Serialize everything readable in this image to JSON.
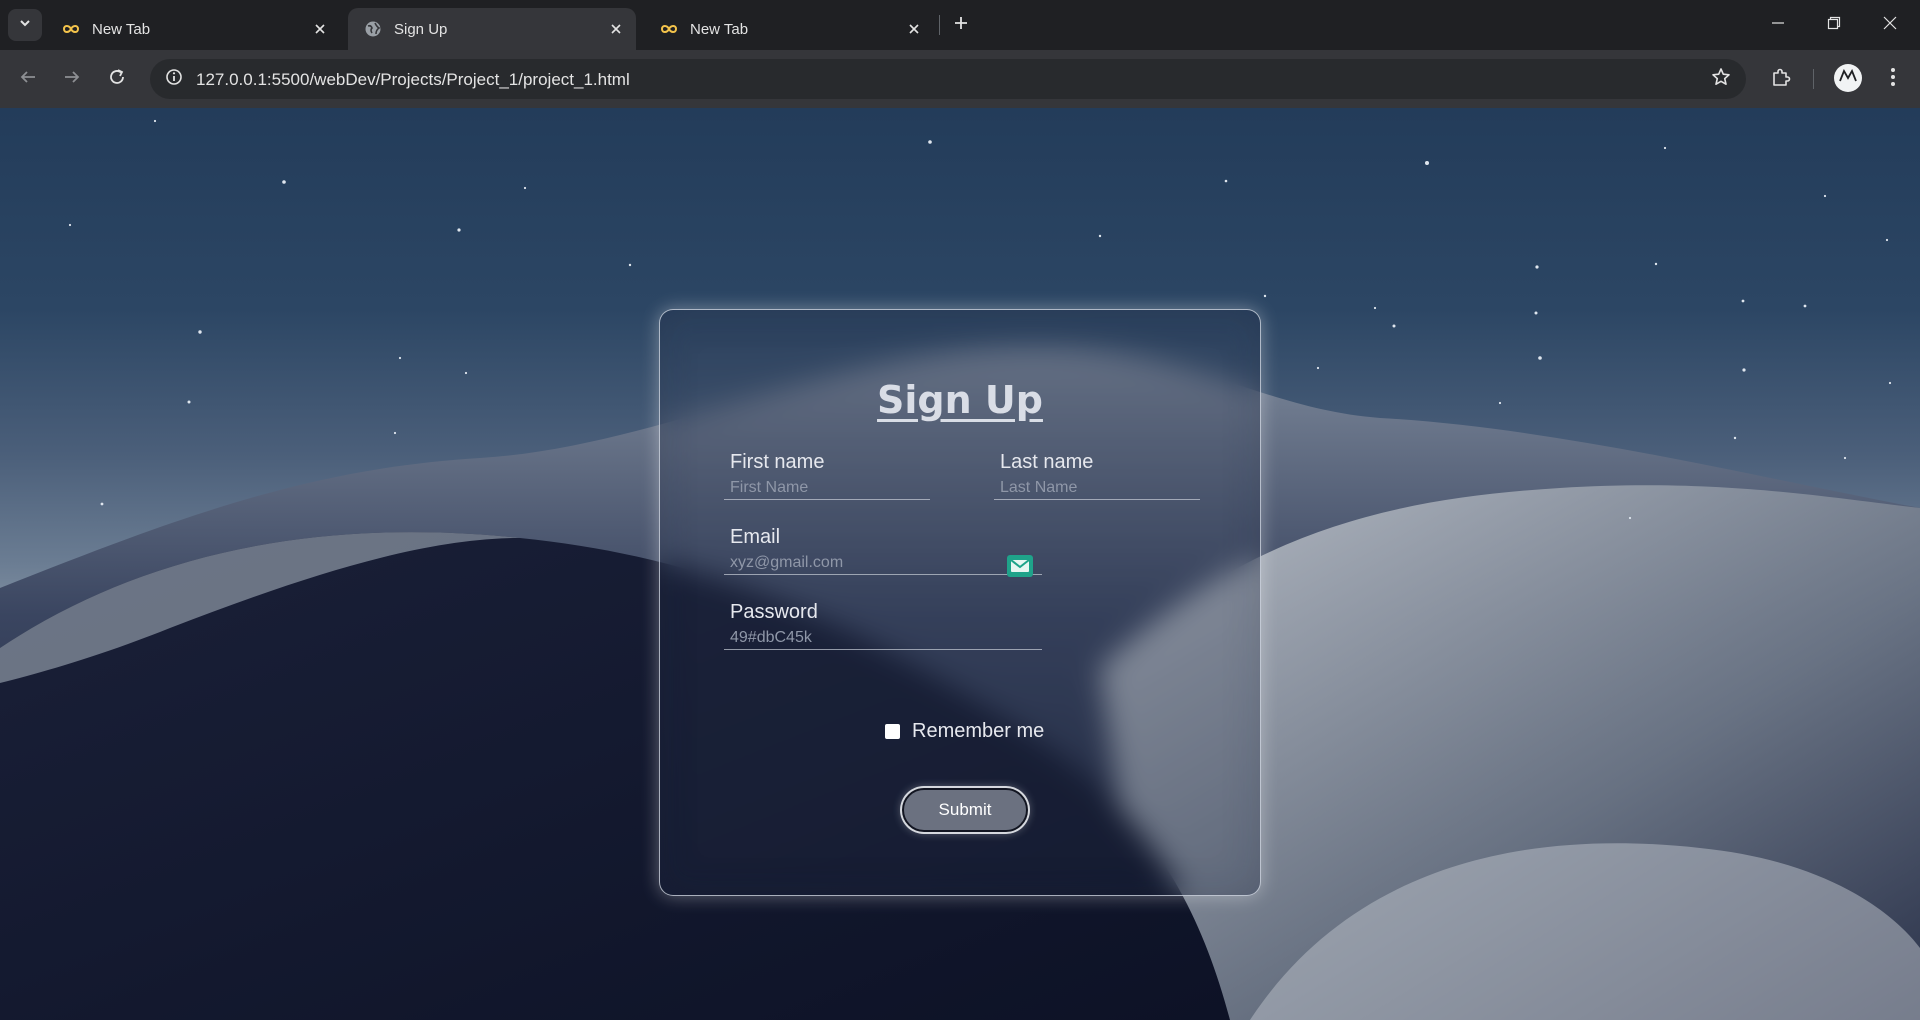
{
  "browser": {
    "tabs": [
      {
        "title": "New Tab",
        "icon": "infinity-icon",
        "active": false
      },
      {
        "title": "Sign Up",
        "icon": "globe-icon",
        "active": true
      },
      {
        "title": "New Tab",
        "icon": "infinity-icon",
        "active": false
      }
    ],
    "url": "127.0.0.1:5500/webDev/Projects/Project_1/project_1.html",
    "profile_initials": "M"
  },
  "form": {
    "title": "Sign Up",
    "first_name": {
      "label": "First name",
      "placeholder": "First Name",
      "value": ""
    },
    "last_name": {
      "label": "Last name",
      "placeholder": "Last Name",
      "value": ""
    },
    "email": {
      "label": "Email",
      "placeholder": "xyz@gmail.com",
      "value": "",
      "icon": "mail-icon"
    },
    "password": {
      "label": "Password",
      "placeholder": "49#dbC45k",
      "value": ""
    },
    "remember": {
      "label": "Remember me",
      "checked": false
    },
    "submit_label": "Submit"
  },
  "colors": {
    "card_border": "#dce1eb",
    "mail_icon": "#1fa38a",
    "submit_bg": "#6b7180"
  }
}
